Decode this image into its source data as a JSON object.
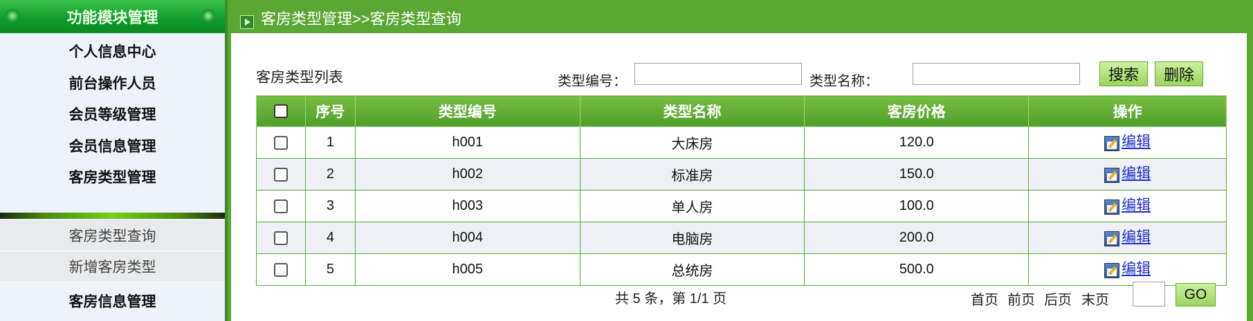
{
  "sidebar": {
    "header": "功能模块管理",
    "items": [
      {
        "label": "个人信息中心"
      },
      {
        "label": "前台操作人员"
      },
      {
        "label": "会员等级管理"
      },
      {
        "label": "会员信息管理"
      },
      {
        "label": "客房类型管理"
      }
    ],
    "submenu": [
      {
        "label": "客房类型查询"
      },
      {
        "label": "新增客房类型"
      }
    ],
    "after_items": [
      {
        "label": "客房信息管理"
      }
    ]
  },
  "titlebar": {
    "breadcrumb": "客房类型管理>>客房类型查询"
  },
  "main": {
    "list_title": "客房类型列表",
    "search": {
      "code_label": "类型编号：",
      "code_value": "",
      "name_label": "类型名称：",
      "name_value": "",
      "search_button": "搜索",
      "delete_button": "删除"
    },
    "table": {
      "headers": [
        "序号",
        "类型编号",
        "类型名称",
        "客房价格",
        "操作"
      ],
      "rows": [
        {
          "no": "1",
          "code": "h001",
          "name": "大床房",
          "price": "120.0",
          "action": "编辑"
        },
        {
          "no": "2",
          "code": "h002",
          "name": "标准房",
          "price": "150.0",
          "action": "编辑"
        },
        {
          "no": "3",
          "code": "h003",
          "name": "单人房",
          "price": "100.0",
          "action": "编辑"
        },
        {
          "no": "4",
          "code": "h004",
          "name": "电脑房",
          "price": "200.0",
          "action": "编辑"
        },
        {
          "no": "5",
          "code": "h005",
          "name": "总统房",
          "price": "500.0",
          "action": "编辑"
        }
      ]
    },
    "pager": {
      "info": "共 5 条，第 1/1 页",
      "first": "首页",
      "prev": "前页",
      "next": "后页",
      "last": "末页",
      "page_value": "",
      "go": "GO"
    }
  },
  "colors": {
    "frame_green": "#5aa733",
    "header_green": "#0e9a2a",
    "sidebar_bg": "#eef2fb",
    "link_blue": "#1a2fcc"
  }
}
